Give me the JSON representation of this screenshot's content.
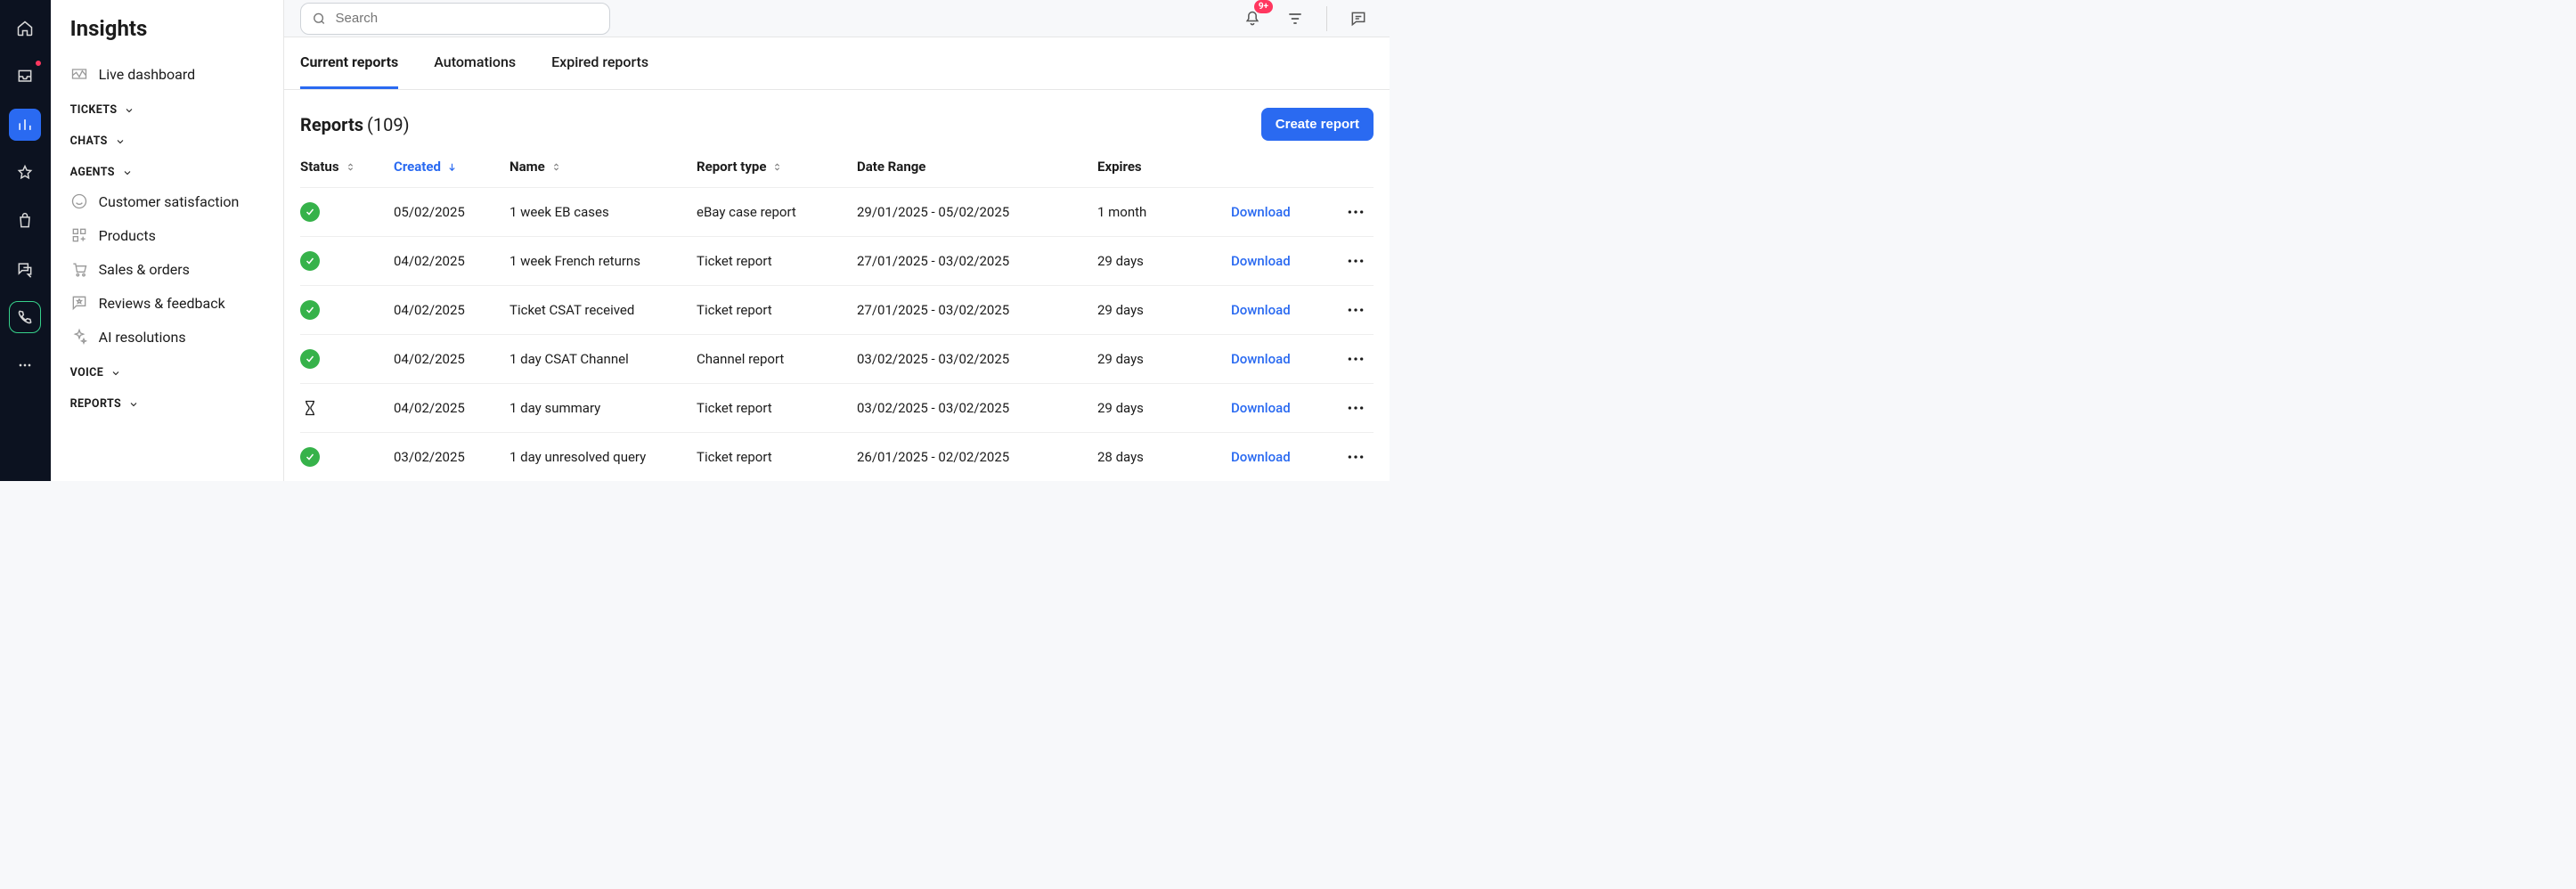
{
  "sidebar": {
    "title": "Insights",
    "live_dashboard": "Live dashboard",
    "sections": {
      "tickets": "TICKETS",
      "chats": "CHATS",
      "agents": "AGENTS",
      "voice": "VOICE",
      "reports": "REPORTS"
    },
    "agent_items": {
      "csat": "Customer satisfaction",
      "products": "Products",
      "sales": "Sales & orders",
      "reviews": "Reviews & feedback",
      "ai": "AI resolutions"
    }
  },
  "topbar": {
    "search_placeholder": "Search",
    "notif_count": "9+"
  },
  "tabs": {
    "current": "Current reports",
    "automations": "Automations",
    "expired": "Expired reports"
  },
  "reports": {
    "title": "Reports",
    "count": "(109)",
    "create_btn": "Create report"
  },
  "columns": {
    "status": "Status",
    "created": "Created",
    "name": "Name",
    "type": "Report type",
    "range": "Date Range",
    "expires": "Expires",
    "download": "Download"
  },
  "rows": [
    {
      "status": "ok",
      "created": "05/02/2025",
      "name": "1 week EB cases",
      "type": "eBay case report",
      "range": "29/01/2025 - 05/02/2025",
      "expires": "1 month"
    },
    {
      "status": "ok",
      "created": "04/02/2025",
      "name": "1 week French returns",
      "type": "Ticket report",
      "range": "27/01/2025 - 03/02/2025",
      "expires": "29 days"
    },
    {
      "status": "ok",
      "created": "04/02/2025",
      "name": "Ticket CSAT received",
      "type": "Ticket report",
      "range": "27/01/2025 - 03/02/2025",
      "expires": "29 days"
    },
    {
      "status": "ok",
      "created": "04/02/2025",
      "name": "1 day CSAT Channel",
      "type": "Channel report",
      "range": "03/02/2025 - 03/02/2025",
      "expires": "29 days"
    },
    {
      "status": "pending",
      "created": "04/02/2025",
      "name": "1 day summary",
      "type": "Ticket report",
      "range": "03/02/2025 - 03/02/2025",
      "expires": "29 days"
    },
    {
      "status": "ok",
      "created": "03/02/2025",
      "name": "1 day unresolved query",
      "type": "Ticket report",
      "range": "26/01/2025 - 02/02/2025",
      "expires": "28 days"
    }
  ]
}
